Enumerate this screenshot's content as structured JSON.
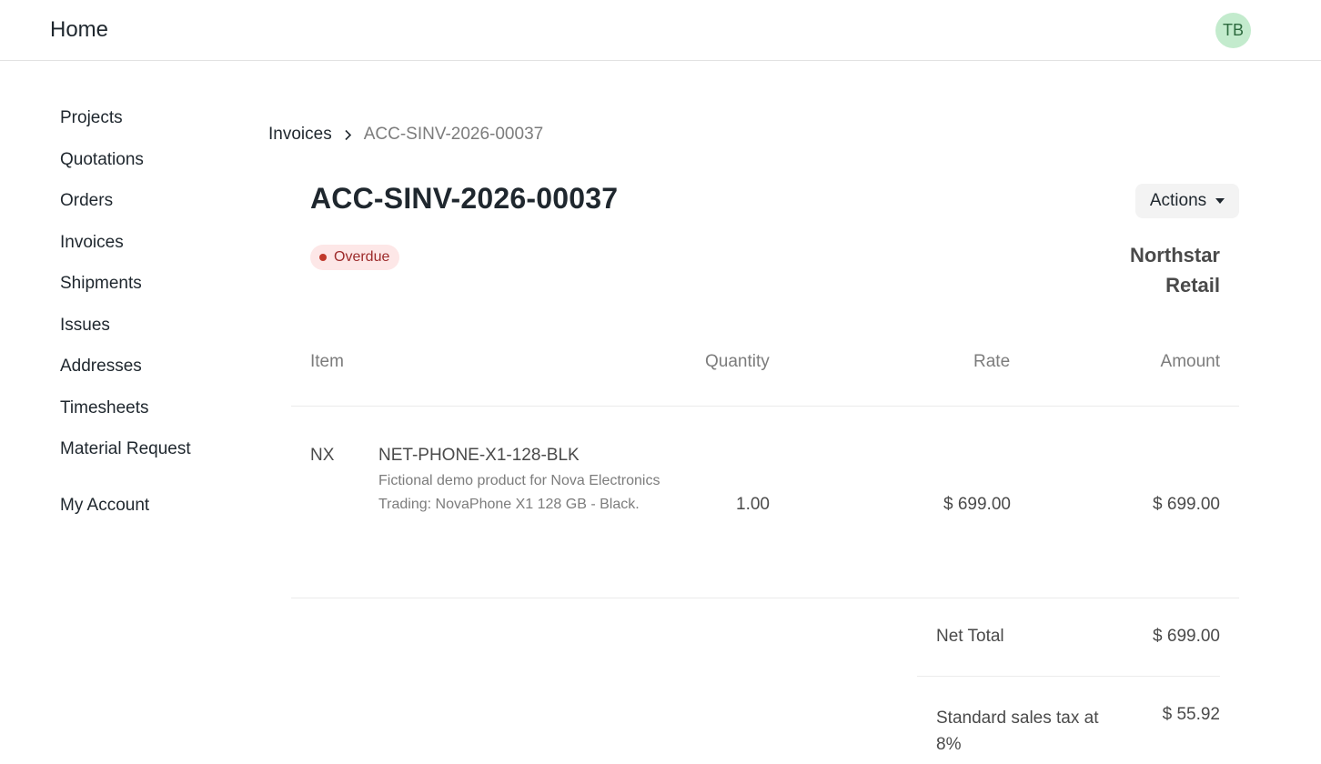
{
  "navbar": {
    "brand": "Home",
    "avatar_initials": "TB"
  },
  "sidebar": {
    "items": [
      {
        "label": "Projects"
      },
      {
        "label": "Quotations"
      },
      {
        "label": "Orders"
      },
      {
        "label": "Invoices"
      },
      {
        "label": "Shipments"
      },
      {
        "label": "Issues"
      },
      {
        "label": "Addresses"
      },
      {
        "label": "Timesheets"
      },
      {
        "label": "Material Request"
      }
    ],
    "account_label": "My Account"
  },
  "breadcrumb": {
    "parent": "Invoices",
    "current": "ACC-SINV-2026-00037",
    "separator_icon": "chevron-right-icon"
  },
  "invoice": {
    "title": "ACC-SINV-2026-00037",
    "status": "Overdue",
    "status_color": "#c0392b",
    "customer_line1": "Northstar",
    "customer_line2": "Retail",
    "actions_label": "Actions"
  },
  "table": {
    "headers": {
      "item": "Item",
      "quantity": "Quantity",
      "rate": "Rate",
      "amount": "Amount"
    },
    "rows": [
      {
        "code": "NX",
        "name": "NET-PHONE-X1-128-BLK",
        "description": "Fictional demo product for Nova Electronics Trading: NovaPhone X1 128 GB - Black.",
        "quantity": "1.00",
        "rate": "$ 699.00",
        "amount": "$ 699.00"
      }
    ]
  },
  "totals": {
    "net_total_label": "Net Total",
    "net_total_value": "$ 699.00",
    "tax_label": "Standard sales tax at 8%",
    "tax_value": "$ 55.92"
  }
}
